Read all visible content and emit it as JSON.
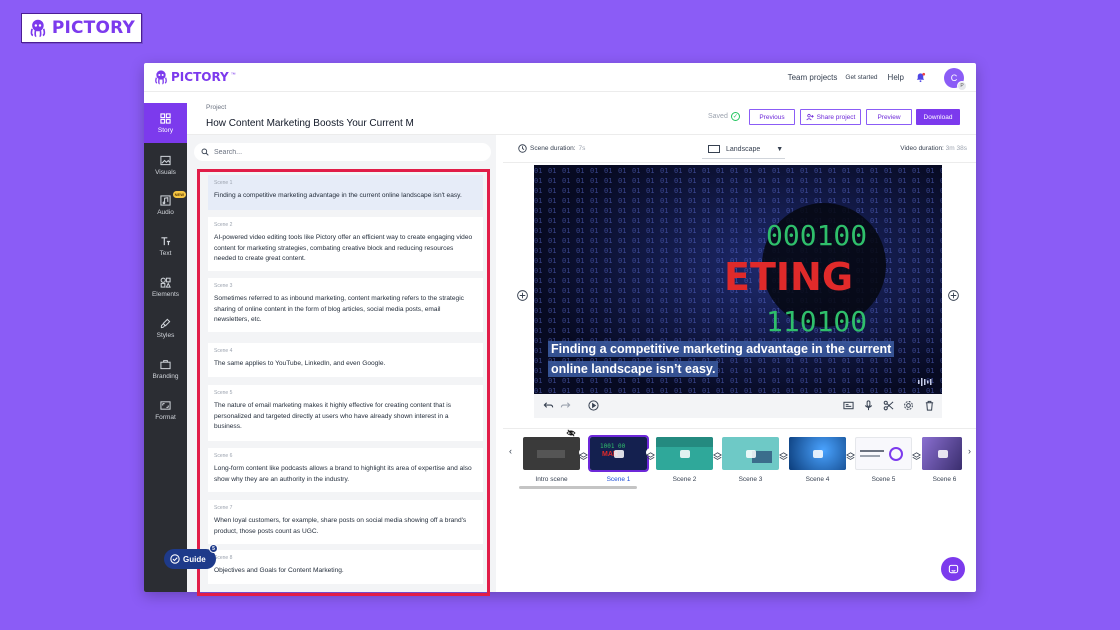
{
  "brand": {
    "name": "PICTORY"
  },
  "topbar": {
    "logo": "PICTORY",
    "tm": "™",
    "nav": [
      "Team projects",
      "Get started",
      "Help"
    ],
    "avatar_initial": "C",
    "avatar_badge": "P"
  },
  "sidebar": {
    "items": [
      {
        "label": "Story",
        "icon": "grid-icon",
        "active": true
      },
      {
        "label": "Visuals",
        "icon": "image-icon"
      },
      {
        "label": "Audio",
        "icon": "music-icon",
        "badge": "NEW"
      },
      {
        "label": "Text",
        "icon": "text-icon"
      },
      {
        "label": "Elements",
        "icon": "shapes-icon"
      },
      {
        "label": "Styles",
        "icon": "brush-icon"
      },
      {
        "label": "Branding",
        "icon": "briefcase-icon"
      },
      {
        "label": "Format",
        "icon": "aspect-icon"
      }
    ]
  },
  "project": {
    "label": "Project",
    "title": "How Content Marketing Boosts Your Current M",
    "saved": "Saved",
    "buttons": {
      "previous": "Previous",
      "share": "Share project",
      "preview": "Preview",
      "download": "Download"
    }
  },
  "search": {
    "placeholder": "Search..."
  },
  "scenes": [
    {
      "num": "Scene 1",
      "text": "Finding a competitive marketing advantage in the current online landscape isn't easy."
    },
    {
      "num": "Scene 2",
      "text": "AI-powered video editing tools like Pictory offer an efficient way to create engaging video content for marketing strategies, combating creative block and reducing resources needed to create great content."
    },
    {
      "num": "Scene 3",
      "text": "Sometimes referred to as inbound marketing, content marketing refers to the strategic sharing of online content in the form of blog articles, social media posts, email newsletters, etc."
    },
    {
      "num": "Scene 4",
      "text": "The same applies to YouTube, LinkedIn, and even Google."
    },
    {
      "num": "Scene 5",
      "text": "The nature of email marketing makes it highly effective for creating content that is personalized and targeted directly at users who have already shown interest in a business."
    },
    {
      "num": "Scene 6",
      "text": "Long-form content like podcasts allows a brand to highlight its area of expertise and also show why they are an authority in the industry."
    },
    {
      "num": "Scene 7",
      "text": "When loyal customers, for example, share posts on social media showing off a brand's product, those posts count as UGC."
    },
    {
      "num": "Scene 8",
      "text": "Objectives and Goals for Content Marketing."
    }
  ],
  "guide": {
    "label": "Guide",
    "count": "5"
  },
  "preview": {
    "scene_duration_label": "Scene duration:",
    "scene_duration": "7s",
    "orientation": "Landscape",
    "video_duration_label": "Video duration:",
    "video_duration": "3m 38s",
    "caption_line1": "Finding a competitive marketing advantage in the current",
    "caption_line2": "online landscape isn’t easy.",
    "video_text_binary1": "000100",
    "video_text_eting": "ETING",
    "video_text_binary2": "110100"
  },
  "timeline": {
    "labels": [
      "Intro scene",
      "Scene 1",
      "Scene 2",
      "Scene 3",
      "Scene 4",
      "Scene 5",
      "Scene 6"
    ],
    "selected": 1
  },
  "colors": {
    "accent": "#7c3aed",
    "highlight": "#e11d48",
    "sidebar": "#2b2d33",
    "background": "#8b5cf6"
  }
}
